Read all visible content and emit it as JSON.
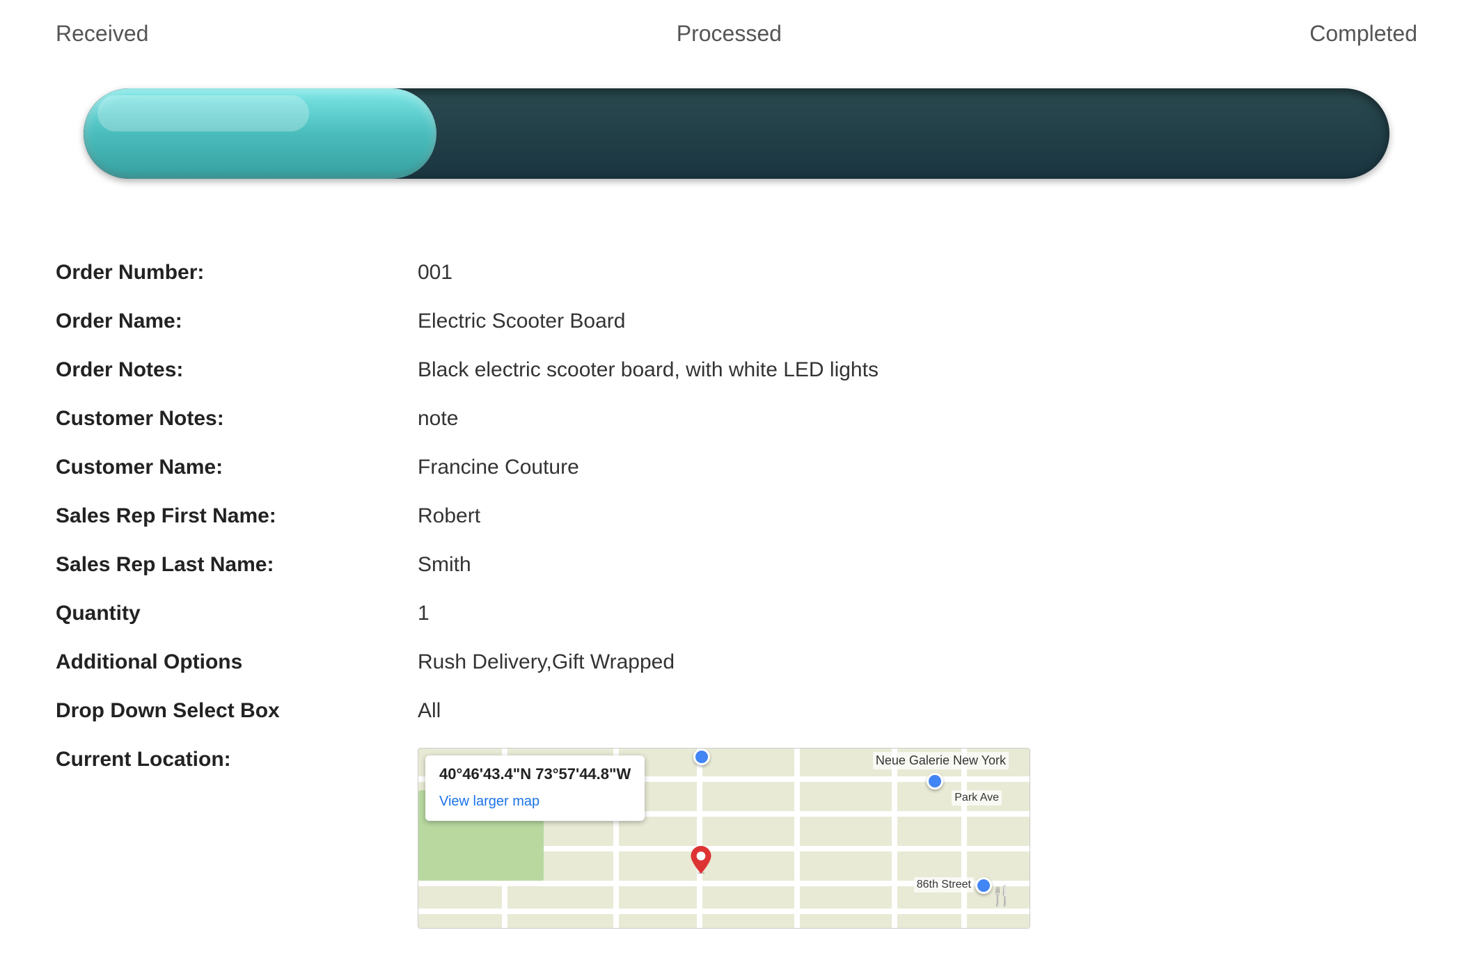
{
  "status": {
    "received": "Received",
    "processed": "Processed",
    "completed": "Completed"
  },
  "progress": {
    "percent": 27
  },
  "order": {
    "number_label": "Order Number:",
    "number_value": "001",
    "name_label": "Order Name:",
    "name_value": "Electric Scooter Board",
    "notes_label": "Order Notes:",
    "notes_value": "Black electric scooter board, with white LED lights",
    "customer_notes_label": "Customer Notes:",
    "customer_notes_value": "note",
    "customer_name_label": "Customer Name:",
    "customer_name_value": "Francine Couture",
    "sales_rep_first_label": "Sales Rep First Name:",
    "sales_rep_first_value": "Robert",
    "sales_rep_last_label": "Sales Rep Last Name:",
    "sales_rep_last_value": "Smith",
    "quantity_label": "Quantity",
    "quantity_value": "1",
    "additional_options_label": "Additional Options",
    "additional_options_value": "Rush Delivery,Gift Wrapped",
    "dropdown_label": "Drop Down Select Box",
    "dropdown_value": "All",
    "location_label": "Current Location:",
    "location_coords": "40°46'43.4\"N 73°57'44.8\"W",
    "location_link": "View larger map"
  }
}
